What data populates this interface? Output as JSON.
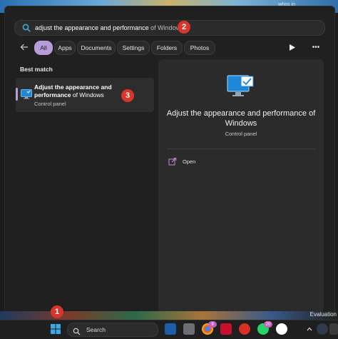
{
  "wallpaper": {
    "edge_text": "whos in"
  },
  "search": {
    "query_bold": "adjust the appearance and performance",
    "query_rest": " of Windows",
    "icon": "search-icon"
  },
  "filters": {
    "back_icon": "back-arrow-icon",
    "chips": [
      "All",
      "Apps",
      "Documents",
      "Settings",
      "Folders",
      "Photos"
    ],
    "active": "All",
    "play_icon": "play-icon",
    "more_label": "•••"
  },
  "best_match": {
    "heading": "Best match",
    "item": {
      "title_bold": "Adjust the appearance and performance",
      "title_rest": " of Windows",
      "subtitle": "Control panel",
      "icon": "monitor-check-icon"
    }
  },
  "preview": {
    "title": "Adjust the appearance and performance of Windows",
    "subtitle": "Control panel",
    "actions": [
      {
        "label": "Open",
        "icon": "open-external-icon"
      }
    ]
  },
  "taskbar": {
    "search_label": "Search",
    "badges": {
      "chrome": "9",
      "whatsapp": "20"
    },
    "eval_text": "Evaluation"
  },
  "markers": [
    "1",
    "2",
    "3"
  ],
  "colors": {
    "accent": "#b89cd9",
    "marker": "#d9352b",
    "panel": "#202020"
  }
}
